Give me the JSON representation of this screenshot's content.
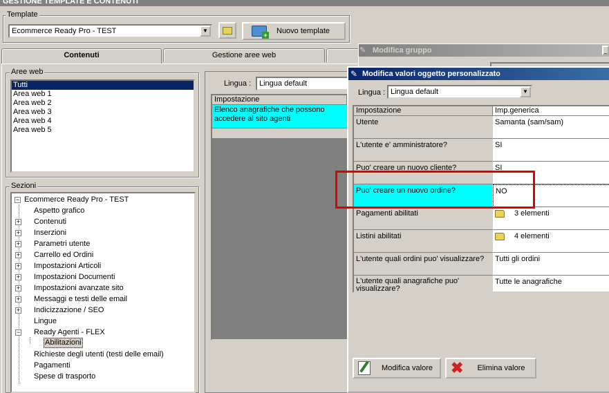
{
  "main_window": {
    "title": "GESTIONE TEMPLATE E CONTENUTI"
  },
  "template": {
    "group_label": "Template",
    "selected": "Ecommerce Ready Pro - TEST",
    "new_button_label": "Nuovo template"
  },
  "tabs": [
    {
      "label": "Contenuti"
    },
    {
      "label": "Gestione aree web"
    }
  ],
  "aree_web": {
    "label": "Aree web",
    "items": [
      "Tutti",
      "Area web 1",
      "Area web 2",
      "Area web 3",
      "Area web 4",
      "Area web 5"
    ],
    "selected": "Tutti"
  },
  "sezioni": {
    "label": "Sezioni",
    "root": "Ecommerce Ready Pro - TEST",
    "items": [
      {
        "label": "Aspetto grafico",
        "expandable": false
      },
      {
        "label": "Contenuti",
        "expandable": true
      },
      {
        "label": "Inserzioni",
        "expandable": true
      },
      {
        "label": "Parametri utente",
        "expandable": true
      },
      {
        "label": "Carrello ed Ordini",
        "expandable": true
      },
      {
        "label": "Impostazioni Articoli",
        "expandable": true
      },
      {
        "label": "Impostazioni Documenti",
        "expandable": true
      },
      {
        "label": "Impostazioni avanzate sito",
        "expandable": true
      },
      {
        "label": "Messaggi e testi delle email",
        "expandable": true
      },
      {
        "label": "Indicizzazione / SEO",
        "expandable": true
      },
      {
        "label": "Lingue",
        "expandable": false
      },
      {
        "label": "Ready Agenti - FLEX",
        "expandable": true,
        "expanded": true
      },
      {
        "label": "Abilitazioni",
        "expandable": false,
        "child": true,
        "selected": true
      },
      {
        "label": "Richieste degli utenti (testi delle email)",
        "expandable": false
      },
      {
        "label": "Pagamenti",
        "expandable": false
      },
      {
        "label": "Spese di trasporto",
        "expandable": false
      }
    ]
  },
  "middle_panel": {
    "lingua_label": "Lingua :",
    "lingua_value": "Lingua default",
    "grid_header": "Impostazione",
    "row_text": "Elenco anagrafiche che possono accedere al sito agenti"
  },
  "modifica_gruppo": {
    "title": "Modifica gruppo"
  },
  "dialog": {
    "title": "Modifica valori oggetto personalizzato",
    "lingua_label": "Lingua :",
    "lingua_value": "Lingua default",
    "columns": [
      "Impostazione",
      "Imp.generica"
    ],
    "rows": [
      {
        "key": "Utente",
        "value": "Samanta (sam/sam)"
      },
      {
        "key": "L'utente e' amministratore?",
        "value": "SI"
      },
      {
        "key": "Puo' creare un nuovo cliente?",
        "value": "SI"
      },
      {
        "key": "Puo' creare un nuovo ordine?",
        "value": "NO",
        "highlighted": true
      },
      {
        "key": "Pagamenti abilitati",
        "value": "3 elementi",
        "icon": "folder-icon"
      },
      {
        "key": "Listini abilitati",
        "value": "4 elementi",
        "icon": "folder-icon"
      },
      {
        "key": "L'utente quali ordini puo' visualizzare?",
        "value": "Tutti gli ordini"
      },
      {
        "key": "L'utente quali anagrafiche puo' visualizzare?",
        "value": "Tutte le anagrafiche"
      }
    ],
    "modify_button": "Modifica valore",
    "delete_button": "Elimina valore"
  },
  "colors": {
    "highlight_cell": "#00ffff",
    "selection": "#0a246a",
    "annotation_box": "#e00000",
    "window_bg": "#d4d0c8"
  }
}
